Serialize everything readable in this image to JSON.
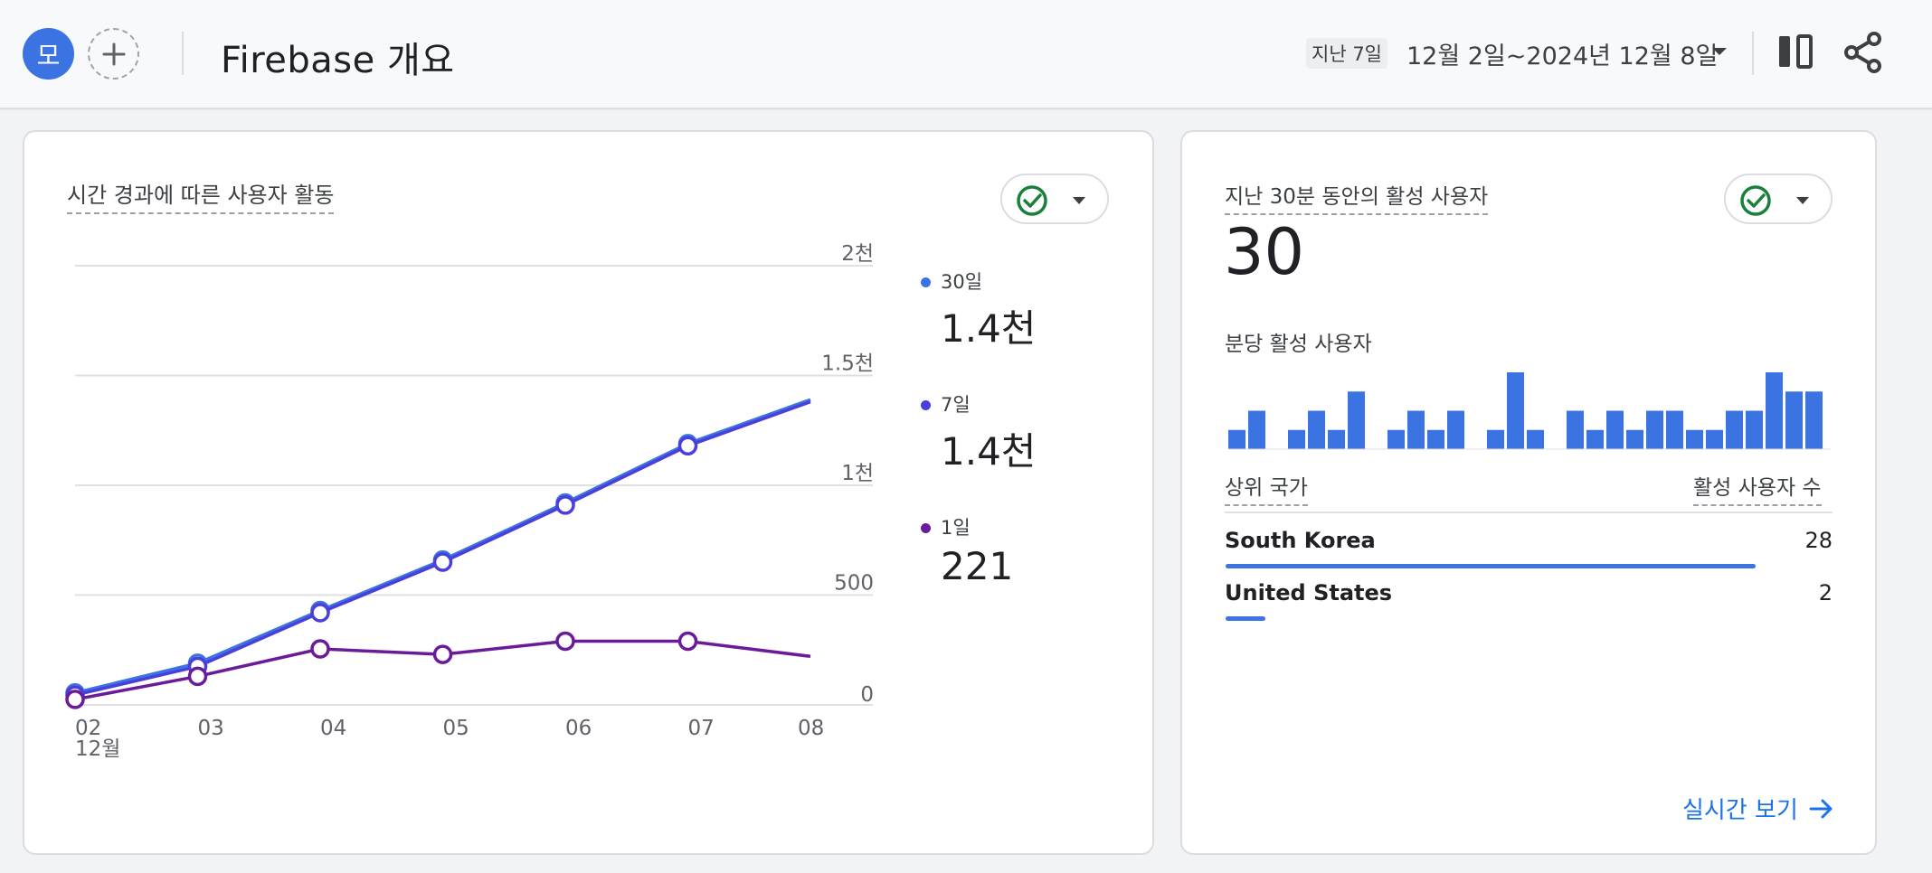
{
  "header": {
    "avatar_letter": "모",
    "title": "Firebase 개요",
    "range_chip": "지난 7일",
    "range_text": "12월 2일~2024년 12월 8일"
  },
  "activity_card": {
    "title": "시간 경과에 따른 사용자 활동",
    "legend": [
      {
        "label": "30일",
        "value": "1.4천",
        "color": "#3b73e3"
      },
      {
        "label": "7일",
        "value": "1.4천",
        "color": "#4a3fd9"
      },
      {
        "label": "1일",
        "value": "221",
        "color": "#6a1b9a"
      }
    ]
  },
  "realtime_card": {
    "title": "지난 30분 동안의 활성 사용자",
    "active_users": "30",
    "per_minute_label": "분당 활성 사용자",
    "per_minute_values": [
      1,
      2,
      0,
      1,
      2,
      1,
      3,
      0,
      1,
      2,
      1,
      2,
      0,
      1,
      4,
      1,
      0,
      2,
      1,
      2,
      1,
      2,
      2,
      1,
      1,
      2,
      2,
      4,
      3,
      3
    ],
    "col_country": "상위 국가",
    "col_users": "활성 사용자 수",
    "countries": [
      {
        "name": "South Korea",
        "count": "28",
        "share": 0.933
      },
      {
        "name": "United States",
        "count": "2",
        "share": 0.067
      }
    ],
    "link_label": "실시간 보기"
  },
  "chart_data": {
    "type": "line",
    "x": [
      "02",
      "03",
      "04",
      "05",
      "06",
      "07",
      "08"
    ],
    "x_sublabel": "12월",
    "yticks": [
      "0",
      "500",
      "1천",
      "1.5천",
      "2천"
    ],
    "ylim": [
      0,
      2000
    ],
    "grid": true,
    "series": [
      {
        "name": "30일",
        "color": "#3b73e3",
        "values": [
          55,
          190,
          430,
          660,
          920,
          1190,
          1390
        ]
      },
      {
        "name": "7일",
        "color": "#4a3fd9",
        "values": [
          45,
          175,
          420,
          650,
          910,
          1180,
          1380
        ]
      },
      {
        "name": "1일",
        "color": "#6a1b9a",
        "values": [
          25,
          130,
          255,
          230,
          290,
          290,
          221
        ]
      }
    ]
  }
}
